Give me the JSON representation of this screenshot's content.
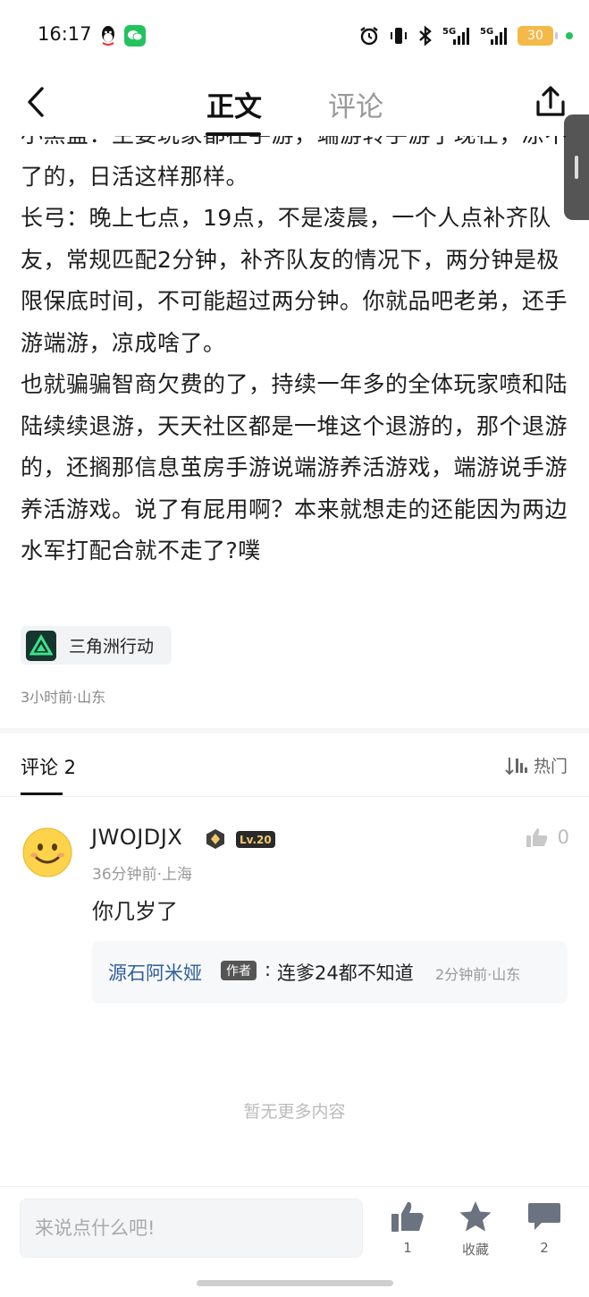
{
  "status_bar": {
    "time": "16:17",
    "battery": "30",
    "icons": [
      "qq-icon",
      "wechat-icon",
      "alarm-icon",
      "vibrate-icon",
      "bluetooth-icon",
      "signal-5g-icon",
      "signal-5g-icon"
    ]
  },
  "nav": {
    "tab_main": "正文",
    "tab_comments": "评论"
  },
  "article": {
    "paragraphs": [
      "小黑盒：主要玩家都在手游，端游转手游了现在，凉不了的，日活这样那样。",
      "长弓：晚上七点，19点，不是凌晨，一个人点补齐队友，常规匹配2分钟，补齐队友的情况下，两分钟是极限保底时间，不可能超过两分钟。你就品吧老弟，还手游端游，凉成啥了。",
      "也就骗骗智商欠费的了，持续一年多的全体玩家喷和陆陆续续退游，天天社区都是一堆这个退游的，那个退游的，还搁那信息茧房手游说端游养活游戏，端游说手游养活游戏。说了有屁用啊？本来就想走的还能因为两边水军打配合就不走了?噗"
    ],
    "tag": "三角洲行动",
    "meta": "3小时前·山东"
  },
  "comments": {
    "title": "评论 2",
    "sort_label": "热门",
    "items": [
      {
        "user": "JWOJDJX",
        "level": "Lv.20",
        "likes": "0",
        "meta": "36分钟前·上海",
        "text": "你几岁了",
        "reply": {
          "user": "源石阿米娅",
          "tag": "作者",
          "colon": ":",
          "text": "连爹24都不知道",
          "meta": "2分钟前·山东"
        }
      }
    ],
    "no_more": "暂无更多内容"
  },
  "bottom_bar": {
    "placeholder": "来说点什么吧!",
    "like_count": "1",
    "favorite_label": "收藏",
    "comment_count": "2"
  },
  "colors": {
    "accent_link": "#2f5e9a",
    "text_primary": "#1a1a1a",
    "text_muted": "#999999",
    "battery": "#f5b94a",
    "wechat": "#22c35e"
  }
}
